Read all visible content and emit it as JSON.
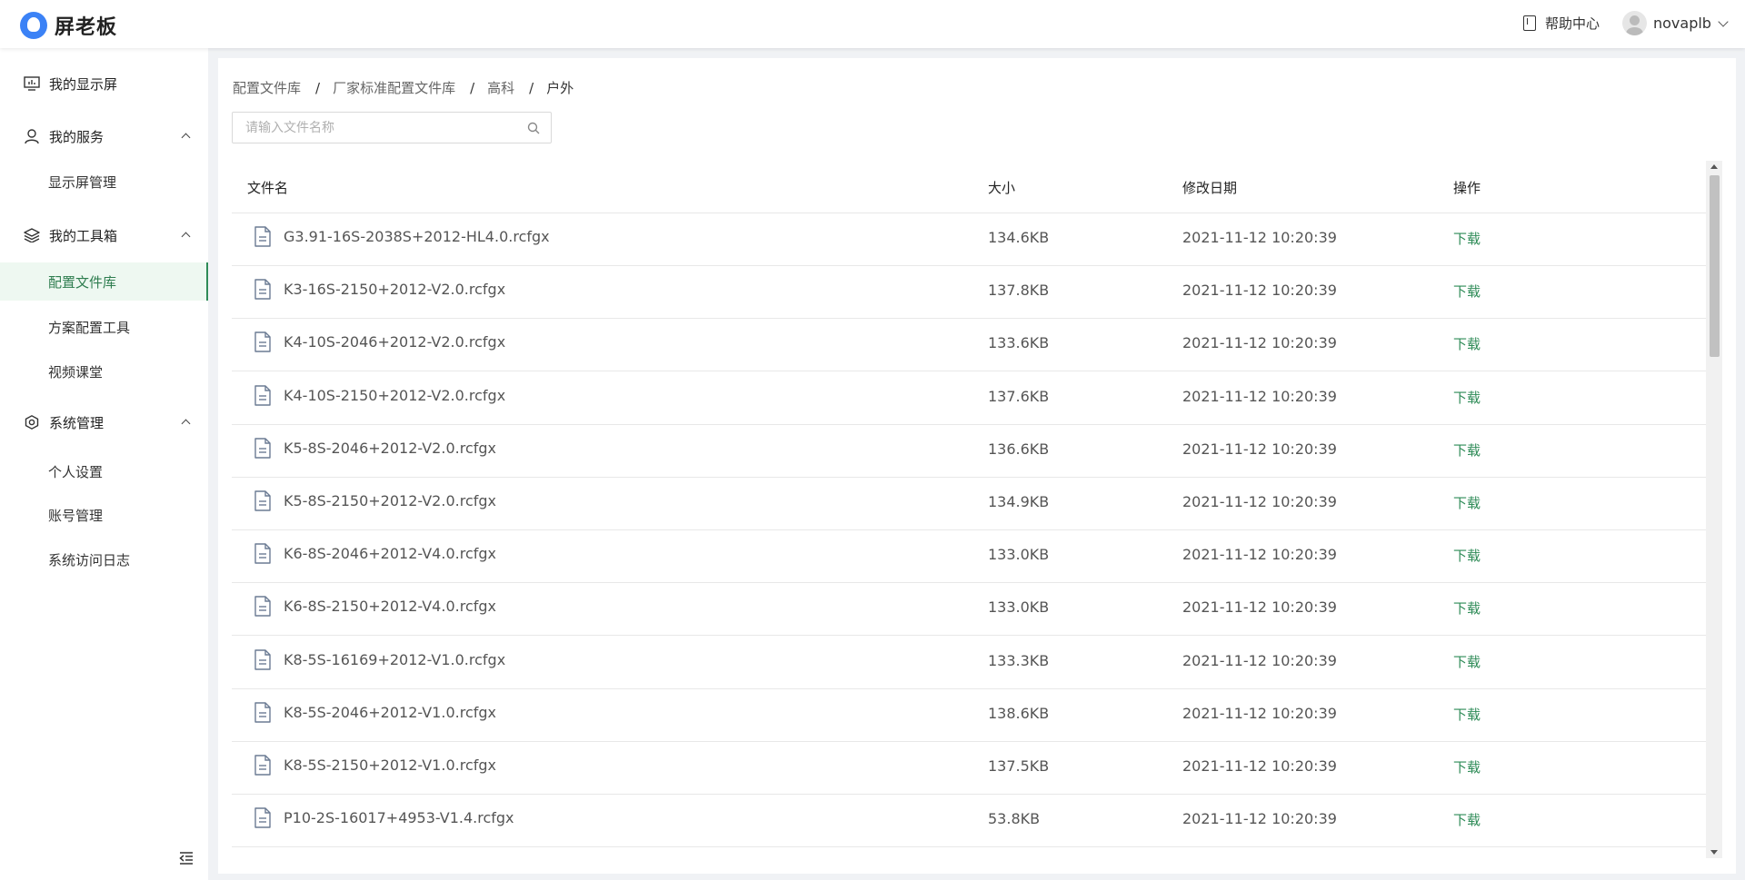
{
  "header": {
    "logo_text": "屏老板",
    "help_label": "帮助中心",
    "user_name": "novaplb"
  },
  "sidebar": {
    "groups": [
      {
        "label": "我的显示屏",
        "icon": "monitor-icon"
      },
      {
        "label": "我的服务",
        "icon": "user-icon",
        "items": [
          {
            "label": "显示屏管理"
          }
        ]
      },
      {
        "label": "我的工具箱",
        "icon": "layers-icon",
        "items": [
          {
            "label": "配置文件库",
            "active": true
          },
          {
            "label": "方案配置工具"
          },
          {
            "label": "视频课堂"
          }
        ]
      },
      {
        "label": "系统管理",
        "icon": "gear-icon",
        "items": [
          {
            "label": "个人设置"
          },
          {
            "label": "账号管理"
          },
          {
            "label": "系统访问日志"
          }
        ]
      }
    ]
  },
  "breadcrumb": [
    "配置文件库",
    "厂家标准配置文件库",
    "高科",
    "户外"
  ],
  "search": {
    "placeholder": "请输入文件名称"
  },
  "table": {
    "columns": [
      "文件名",
      "大小",
      "修改日期",
      "操作"
    ],
    "action_label": "下载",
    "rows": [
      {
        "name": "G3.91-16S-2038S+2012-HL4.0.rcfgx",
        "size": "134.6KB",
        "date": "2021-11-12 10:20:39"
      },
      {
        "name": "K3-16S-2150+2012-V2.0.rcfgx",
        "size": "137.8KB",
        "date": "2021-11-12 10:20:39"
      },
      {
        "name": "K4-10S-2046+2012-V2.0.rcfgx",
        "size": "133.6KB",
        "date": "2021-11-12 10:20:39"
      },
      {
        "name": "K4-10S-2150+2012-V2.0.rcfgx",
        "size": "137.6KB",
        "date": "2021-11-12 10:20:39"
      },
      {
        "name": "K5-8S-2046+2012-V2.0.rcfgx",
        "size": "136.6KB",
        "date": "2021-11-12 10:20:39"
      },
      {
        "name": "K5-8S-2150+2012-V2.0.rcfgx",
        "size": "134.9KB",
        "date": "2021-11-12 10:20:39"
      },
      {
        "name": "K6-8S-2046+2012-V4.0.rcfgx",
        "size": "133.0KB",
        "date": "2021-11-12 10:20:39"
      },
      {
        "name": "K6-8S-2150+2012-V4.0.rcfgx",
        "size": "133.0KB",
        "date": "2021-11-12 10:20:39"
      },
      {
        "name": "K8-5S-16169+2012-V1.0.rcfgx",
        "size": "133.3KB",
        "date": "2021-11-12 10:20:39"
      },
      {
        "name": "K8-5S-2046+2012-V1.0.rcfgx",
        "size": "138.6KB",
        "date": "2021-11-12 10:20:39"
      },
      {
        "name": "K8-5S-2150+2012-V1.0.rcfgx",
        "size": "137.5KB",
        "date": "2021-11-12 10:20:39"
      },
      {
        "name": "P10-2S-16017+4953-V1.4.rcfgx",
        "size": "53.8KB",
        "date": "2021-11-12 10:20:39"
      }
    ]
  },
  "colors": {
    "accent": "#2e8b57",
    "logo": "#3b82f6"
  }
}
